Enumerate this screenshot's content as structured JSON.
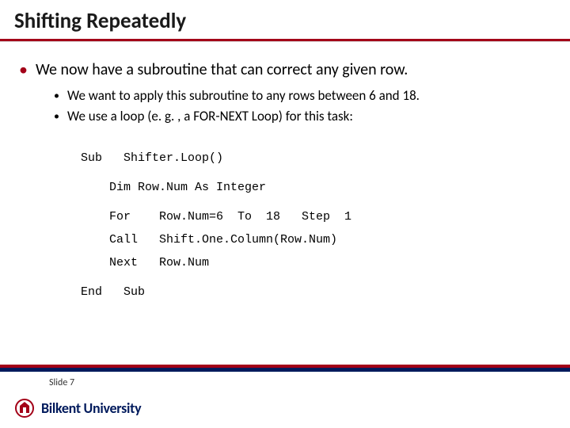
{
  "title": "Shifting Repeatedly",
  "bullets": {
    "l1": "We now have a subroutine that can correct any given row.",
    "l2a": "We want to apply this subroutine to any rows between 6 and 18.",
    "l2b": "We use a loop (e. g. , a FOR-NEXT  Loop) for this task:"
  },
  "code": {
    "l1": "Sub   Shifter.Loop()",
    "l2": "    Dim Row.Num As Integer",
    "l3": "    For    Row.Num=6  To  18   Step  1",
    "l4": "    Call   Shift.One.Column(Row.Num)",
    "l5": "    Next   Row.Num",
    "l6": "End   Sub"
  },
  "footer": {
    "slide": "Slide 7",
    "uni": "Bilkent University"
  }
}
